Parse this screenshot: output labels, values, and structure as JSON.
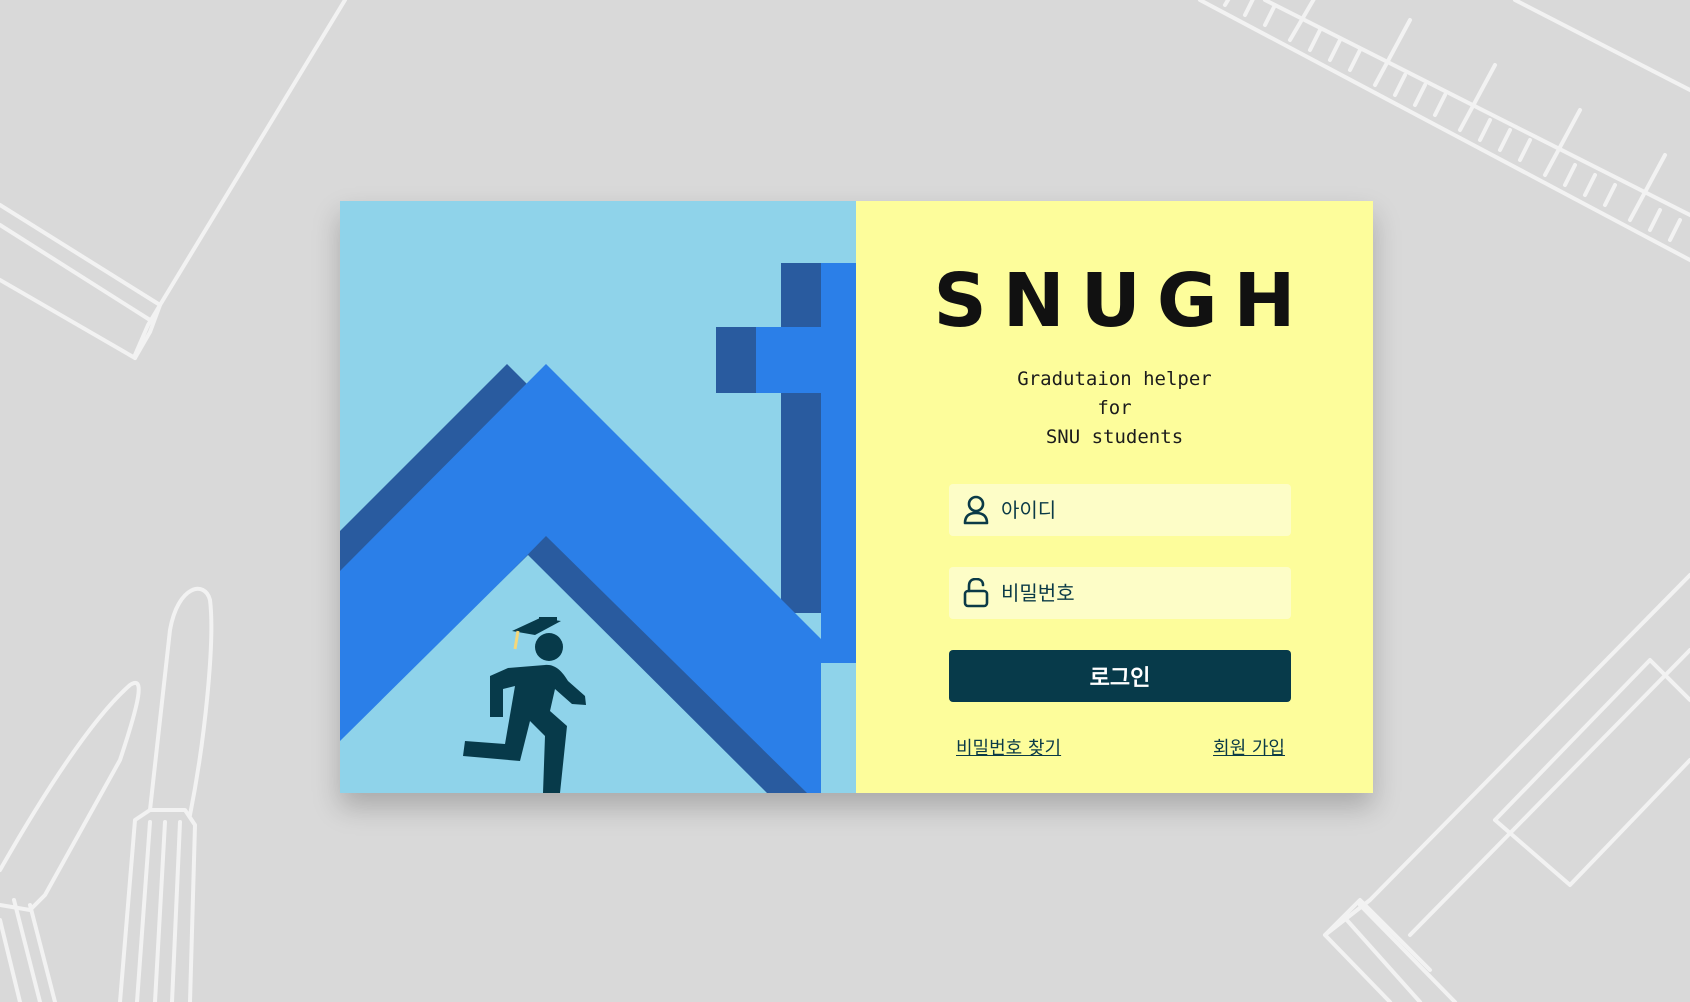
{
  "app": {
    "brand": "SNUGH",
    "tagline": [
      "Gradutaion helper",
      "for",
      "SNU students"
    ]
  },
  "login": {
    "id_placeholder": "아이디",
    "password_placeholder": "비밀번호",
    "submit_label": "로그인",
    "find_password_label": "비밀번호 찾기",
    "signup_label": "회원 가입"
  },
  "icons": {
    "id_field": "user-icon",
    "password_field": "lock-icon",
    "illustration": "graduate-running-icon"
  },
  "colors": {
    "background": "#d9d9d9",
    "art_panel": "#8fd3ea",
    "roof_primary": "#2b7fe8",
    "roof_shadow": "#295b9f",
    "form_panel": "#fdfd9b",
    "input_bg": "#fdfdc7",
    "primary_dark": "#073a4a"
  }
}
